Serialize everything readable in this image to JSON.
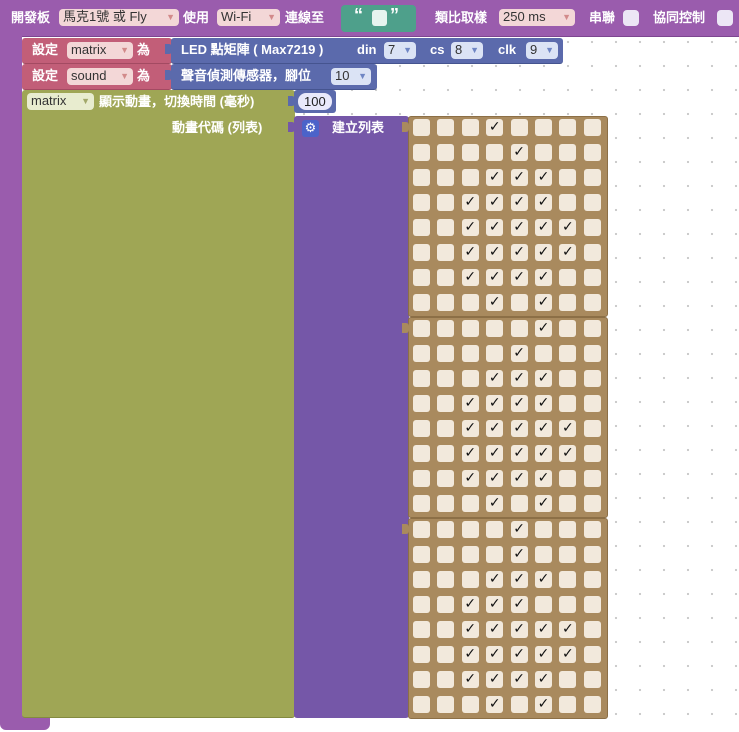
{
  "top_block": {
    "label_board": "開發板",
    "board_value": "馬克1號 或 Fly",
    "label_use": "使用",
    "connection_value": "Wi-Fi",
    "label_connect_to": "連線至",
    "quote_open": "“",
    "quote_close": "”",
    "label_sampling": "類比取樣",
    "sampling_value": "250 ms",
    "label_serial": "串聯",
    "label_coop": "協同控制"
  },
  "set_matrix": {
    "label_set": "設定",
    "var_name": "matrix",
    "label_as": "為",
    "device_label": "LED 點矩陣 ( Max7219 )",
    "din_label": "din",
    "din_value": "7",
    "cs_label": "cs",
    "cs_value": "8",
    "clk_label": "clk",
    "clk_value": "9"
  },
  "set_sound": {
    "label_set": "設定",
    "var_name": "sound",
    "label_as": "為",
    "device_label": "聲音偵測傳感器，腳位",
    "pin_value": "10"
  },
  "animation": {
    "var_name": "matrix",
    "label": "顯示動畫，切換時間 (毫秒)",
    "interval": "100",
    "code_label": "動畫代碼 (列表)",
    "create_list_label": "建立列表",
    "frames": [
      [
        "00010000",
        "00001000",
        "00011100",
        "00111100",
        "00111110",
        "00111110",
        "00111100",
        "00010100"
      ],
      [
        "00000100",
        "00001000",
        "00011100",
        "00111100",
        "00111110",
        "00111110",
        "00111100",
        "00010100"
      ],
      [
        "00001000",
        "00001000",
        "00011100",
        "00111000",
        "00111110",
        "00111110",
        "00111100",
        "00010100"
      ]
    ]
  },
  "colors": {
    "purple": "#9a5cad",
    "set_red": "#c25e78",
    "device_blue": "#5b6aac",
    "animation_olive": "#9fa655",
    "list_purple": "#7557a8",
    "matrix_brown": "#a98a5e",
    "text_teal": "#4ea08b"
  }
}
